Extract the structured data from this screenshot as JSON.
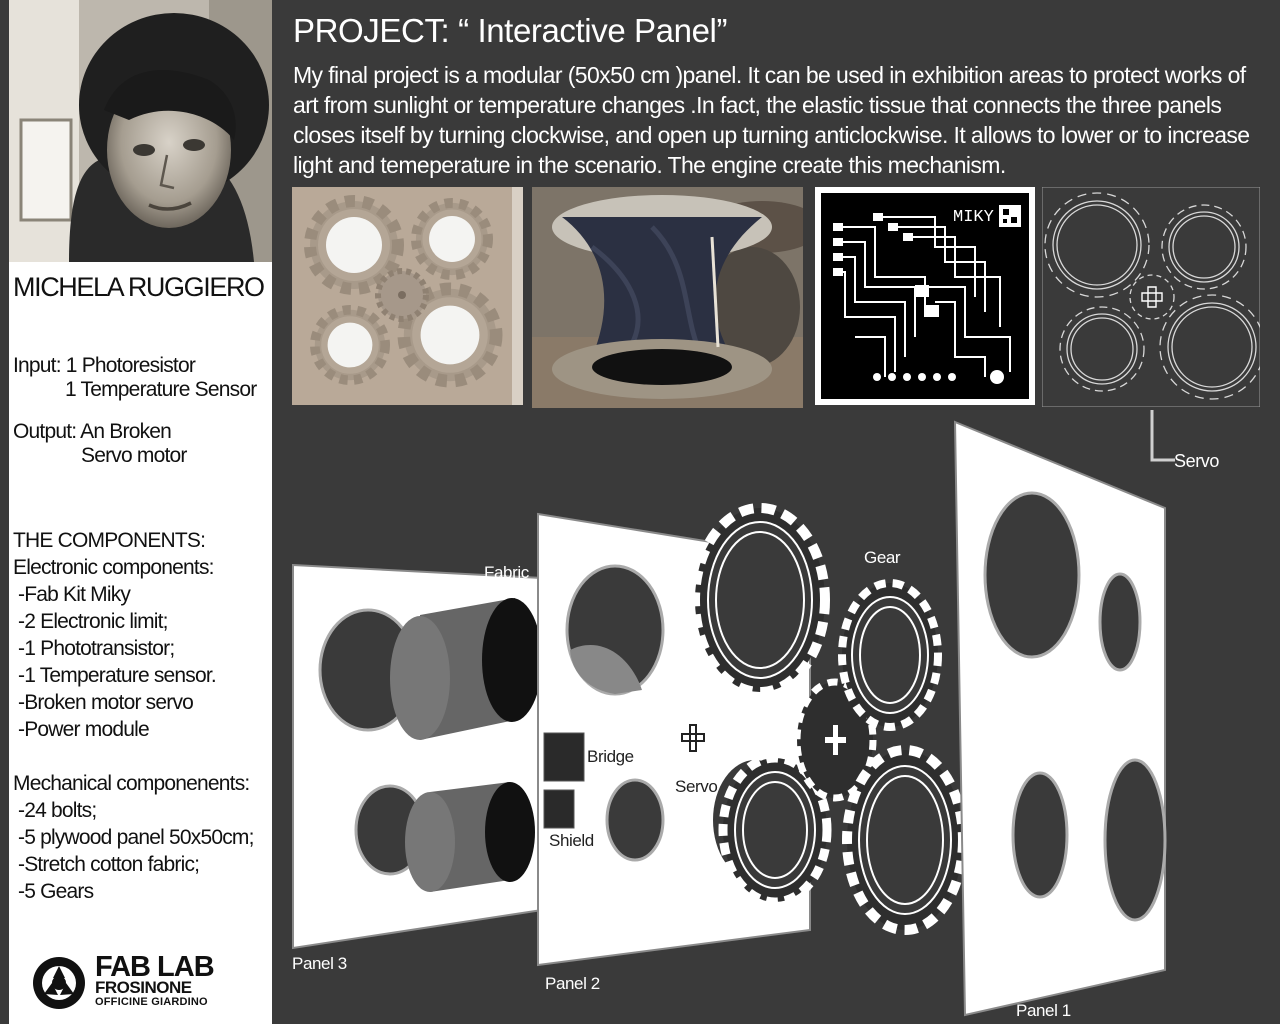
{
  "author": "MICHELA RUGGIERO",
  "inputs": {
    "label": "Input:",
    "items": [
      "1 Photoresistor",
      "1 Temperature Sensor"
    ]
  },
  "outputs": {
    "label": "Output:",
    "items": [
      "An Broken",
      "Servo motor"
    ]
  },
  "components": {
    "heading": "THE COMPONENTS:",
    "electronic_heading": "Electronic components:",
    "electronic": [
      "-Fab Kit Miky",
      "-2 Electronic limit;",
      "-1 Phototransistor;",
      "-1 Temperature sensor.",
      "-Broken motor servo",
      "-Power module"
    ],
    "mechanical_heading": "Mechanical componenents:",
    "mechanical": [
      "-24 bolts;",
      "-5 plywood panel 50x50cm;",
      "-Stretch cotton fabric;",
      "-5 Gears"
    ]
  },
  "logo": {
    "name": "FAB LAB",
    "city": "FROSINONE",
    "subtitle": "OFFICINE GIARDINO"
  },
  "project": {
    "title": "PROJECT: “ Interactive Panel”",
    "description": "My final project is a modular (50x50 cm )panel. It can be used in exhibition areas to protect works of art from sunlight or temperature changes .In fact, the elastic tissue that connects the three panels closes itself by turning clockwise, and open up turning anticlockwise. It allows to lower or to increase light and temeperature in the scenario. The engine create this mechanism."
  },
  "pcb_label": "MIKY",
  "diagram_labels": {
    "servo_top": "Servo",
    "fabric": "Fabric",
    "gear": "Gear",
    "bridge": "Bridge",
    "servo": "Servo",
    "shield": "Shield",
    "panel3": "Panel 3",
    "panel2": "Panel 2",
    "panel1": "Panel 1"
  },
  "colors": {
    "background": "#3a3a3a",
    "sidebar": "#ffffff",
    "cardboard": "#b9a998",
    "fabric": "#2b3042"
  }
}
